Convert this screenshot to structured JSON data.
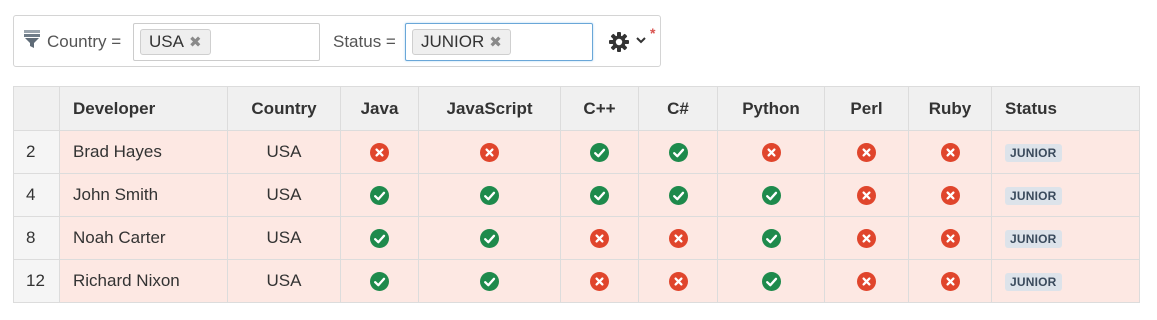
{
  "filter_bar": {
    "country_label": "Country =",
    "country_value": "USA",
    "status_label": "Status =",
    "status_value": "JUNIOR",
    "remove_glyph": "✖",
    "settings_icon": "gear-icon",
    "menu_icon": "chevron-down-icon",
    "modified_marker": "*"
  },
  "colors": {
    "yes": "#1e8a4c",
    "no": "#e0452c",
    "row_bg": "#fde8e3",
    "header_bg": "#f0f0f0",
    "badge_bg": "#dde3ea"
  },
  "table": {
    "columns": [
      "",
      "Developer",
      "Country",
      "Java",
      "JavaScript",
      "C++",
      "C#",
      "Python",
      "Perl",
      "Ruby",
      "Status"
    ],
    "rows": [
      {
        "id": "2",
        "developer": "Brad Hayes",
        "country": "USA",
        "skills": [
          false,
          false,
          true,
          true,
          false,
          false,
          false
        ],
        "status": "JUNIOR"
      },
      {
        "id": "4",
        "developer": "John Smith",
        "country": "USA",
        "skills": [
          true,
          true,
          true,
          true,
          true,
          false,
          false
        ],
        "status": "JUNIOR"
      },
      {
        "id": "8",
        "developer": "Noah Carter",
        "country": "USA",
        "skills": [
          true,
          true,
          false,
          false,
          true,
          false,
          false
        ],
        "status": "JUNIOR"
      },
      {
        "id": "12",
        "developer": "Richard Nixon",
        "country": "USA",
        "skills": [
          true,
          true,
          false,
          false,
          true,
          false,
          false
        ],
        "status": "JUNIOR"
      }
    ]
  }
}
